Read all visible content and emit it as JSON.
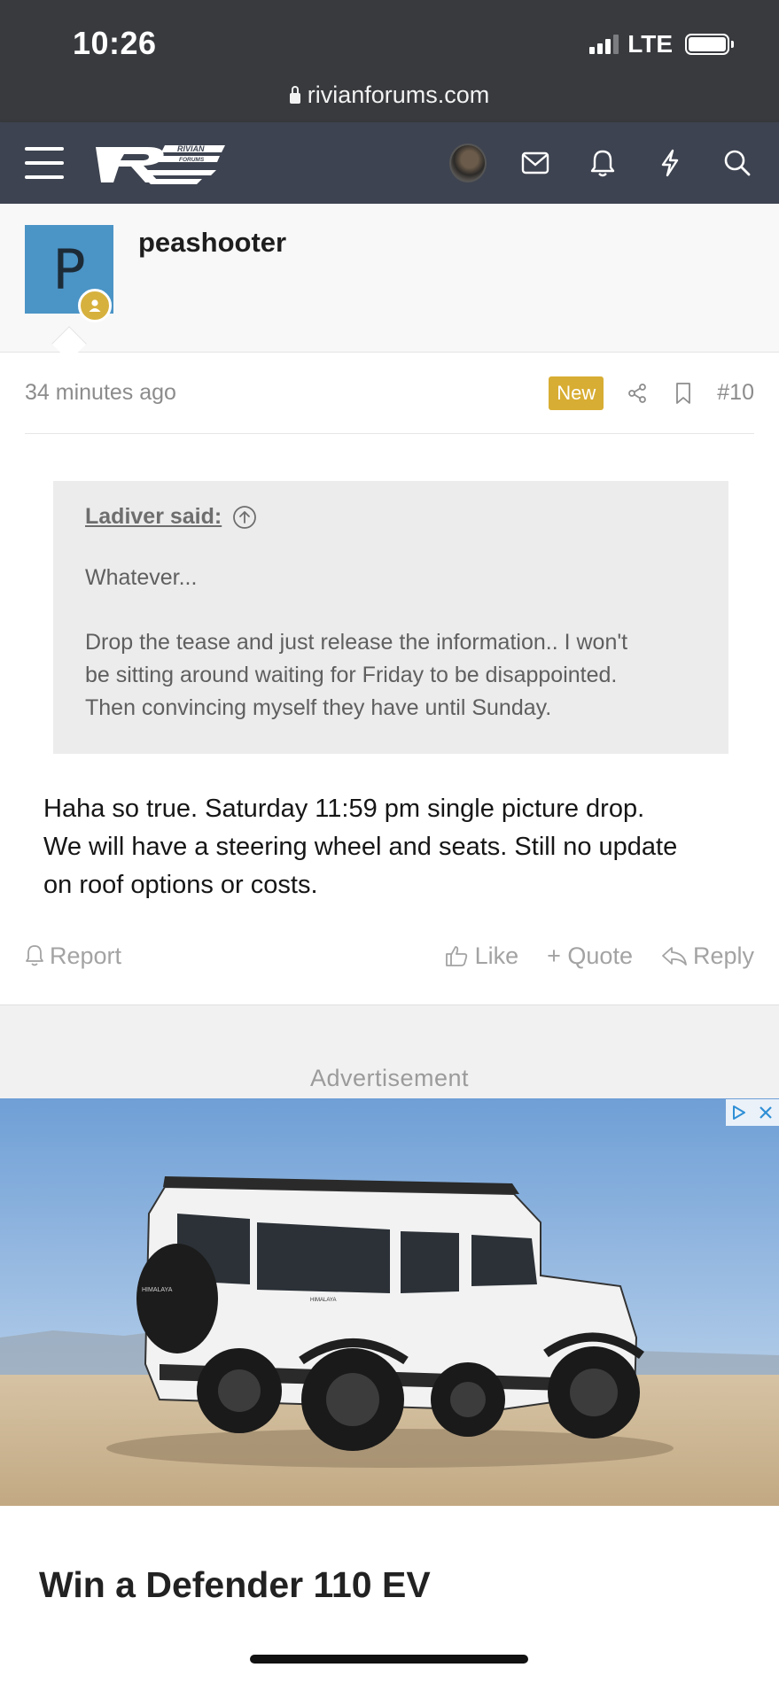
{
  "status_bar": {
    "time": "10:26",
    "network": "LTE"
  },
  "browser": {
    "url": "rivianforums.com"
  },
  "header": {
    "logo_text": "RIVIAN FORUMS",
    "icons": [
      "menu-icon",
      "avatar",
      "mail-icon",
      "bell-icon",
      "bolt-icon",
      "search-icon"
    ]
  },
  "post": {
    "author_initial": "P",
    "username": "peashooter",
    "time": "34 minutes ago",
    "badge": "New",
    "number": "#10",
    "quote": {
      "author": "Ladiver said:",
      "line1": "Whatever...",
      "body": "Drop the tease and just release the information.. I won't\nbe sitting around waiting for Friday to be disappointed.\nThen convincing myself they have until Sunday."
    },
    "body": "Haha so true. Saturday 11:59 pm single picture drop.\nWe will have a steering wheel and seats. Still no update\non roof options or costs.",
    "actions": {
      "report": "Report",
      "like": "Like",
      "quote": "+ Quote",
      "reply": "Reply"
    }
  },
  "ad": {
    "label": "Advertisement",
    "spare_wheel_text": "HIMALAYA",
    "side_text": "HIMALAYA",
    "title": "Win a Defender 110 EV"
  },
  "colors": {
    "header_bg": "#3d4350",
    "status_bg": "#383a3e",
    "avatar_bg": "#4b94c6",
    "badge_new": "#d8ad33"
  }
}
